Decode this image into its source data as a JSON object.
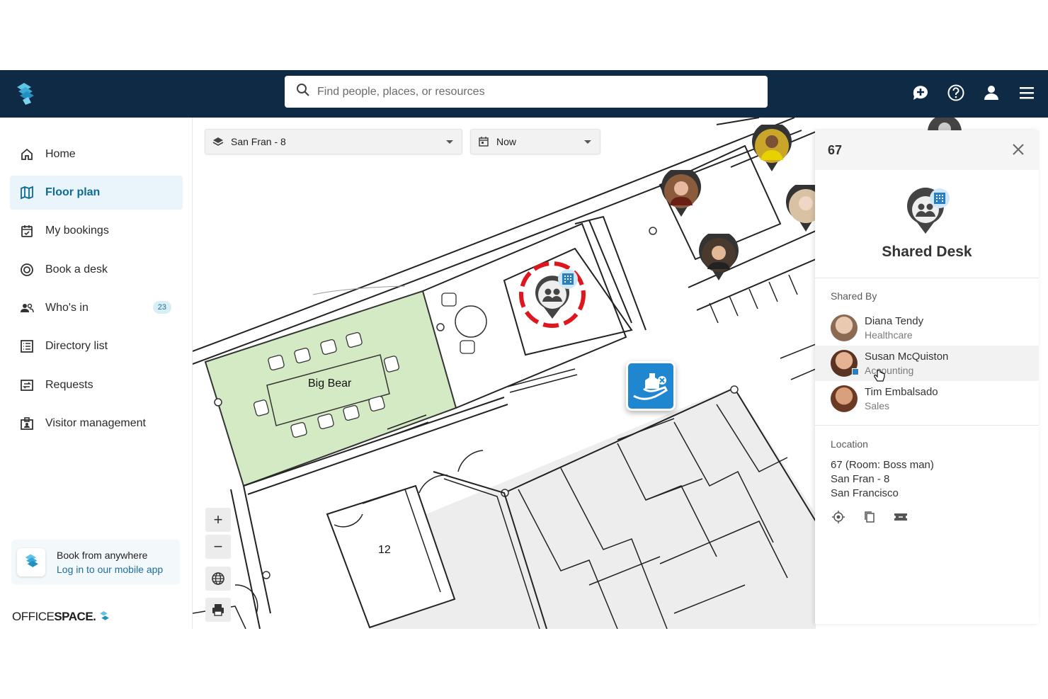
{
  "search": {
    "placeholder": "Find people, places, or resources"
  },
  "sidebar": {
    "items": [
      {
        "label": "Home"
      },
      {
        "label": "Floor plan"
      },
      {
        "label": "My bookings"
      },
      {
        "label": "Book a desk"
      },
      {
        "label": "Who's in",
        "badge": "23"
      },
      {
        "label": "Directory list"
      },
      {
        "label": "Requests"
      },
      {
        "label": "Visitor management"
      }
    ],
    "promo": {
      "title": "Book from anywhere",
      "link": "Log in to our mobile app"
    },
    "brand": {
      "part1": "OFFICE",
      "part2": "SPACE."
    }
  },
  "map": {
    "floor_select": "San Fran - 8",
    "time_select": "Now",
    "rooms": {
      "big_bear": "Big Bear",
      "room_12": "12"
    },
    "zoom_in": "+",
    "zoom_out": "−"
  },
  "panel": {
    "id": "67",
    "title": "Shared Desk",
    "shared_by_label": "Shared By",
    "people": [
      {
        "name": "Diana Tendy",
        "dept": "Healthcare"
      },
      {
        "name": "Susan McQuiston",
        "dept": "Accounting"
      },
      {
        "name": "Tim Embalsado",
        "dept": "Sales"
      }
    ],
    "location_label": "Location",
    "location_lines": [
      "67 (Room: Boss man)",
      "San Fran - 8",
      "San Francisco"
    ]
  },
  "colors": {
    "topbar": "#0f2a44",
    "accent": "#0d6b96",
    "room_green": "#d4eac4",
    "selection_red": "#e0161e"
  }
}
